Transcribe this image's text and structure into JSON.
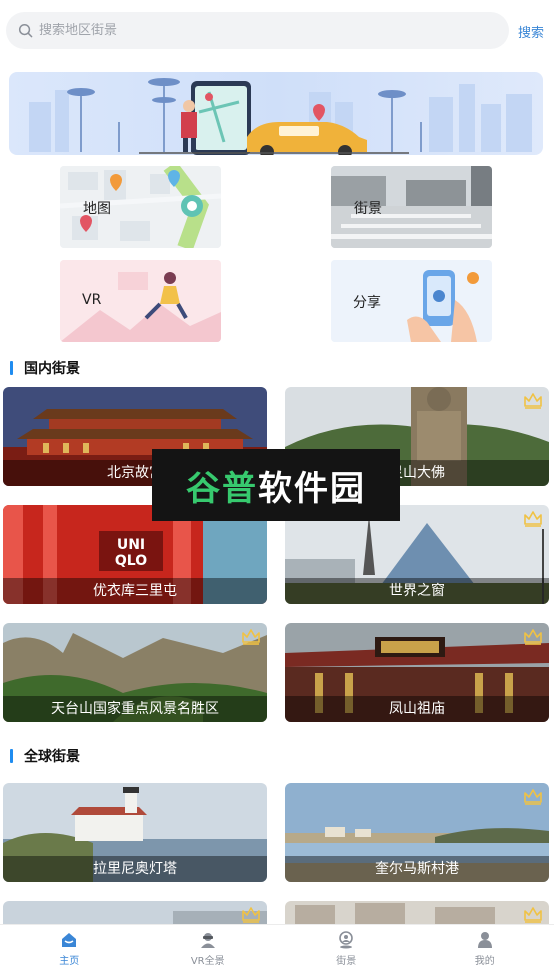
{
  "search": {
    "placeholder": "搜索地区街景",
    "button_label": "搜索"
  },
  "features": [
    {
      "label": "地图",
      "icon": "map-icon"
    },
    {
      "label": "街景",
      "icon": "street-icon"
    },
    {
      "label": "VR",
      "icon": "vr-icon"
    },
    {
      "label": "分享",
      "icon": "share-icon"
    }
  ],
  "domestic": {
    "title": "国内街景",
    "cards": [
      {
        "name": "北京故宫",
        "premium": false
      },
      {
        "name": "灵山大佛",
        "premium": true
      },
      {
        "name": "优衣库三里屯",
        "premium": false
      },
      {
        "name": "世界之窗",
        "premium": true
      },
      {
        "name": "天台山国家重点风景名胜区",
        "premium": true
      },
      {
        "name": "凤山祖庙",
        "premium": true
      }
    ]
  },
  "global": {
    "title": "全球街景",
    "cards": [
      {
        "name": "拉里尼奥灯塔",
        "premium": false
      },
      {
        "name": "奎尔马斯村港",
        "premium": true
      }
    ]
  },
  "watermark": {
    "part1": "谷普",
    "part2": "软件园"
  },
  "nav": [
    {
      "label": "主页",
      "icon": "home-icon",
      "active": true
    },
    {
      "label": "VR全景",
      "icon": "vr-panorama-icon",
      "active": false
    },
    {
      "label": "街景",
      "icon": "street-view-icon",
      "active": false
    },
    {
      "label": "我的",
      "icon": "profile-icon",
      "active": false
    }
  ],
  "colors": {
    "accent": "#3a86d6",
    "section_bar": "#1f8cf0",
    "premium_crown": "#f0c244"
  }
}
